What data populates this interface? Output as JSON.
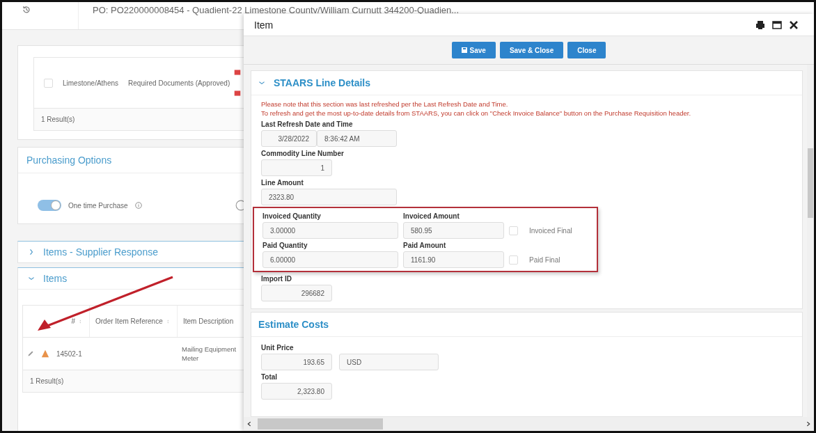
{
  "header": {
    "title": "PO: PO220000008454 - Quadient-22 Limestone Countv/William Curnutt 344200-Quadien..."
  },
  "documents": {
    "rows": [
      {
        "checked": false,
        "location": "Limestone/Athens",
        "document": "Required Documents (Approved)"
      }
    ],
    "footer": "1 Result(s)"
  },
  "purchasing_options": {
    "title": "Purchasing Options",
    "toggle": {
      "label": "One time Purchase",
      "on": true
    }
  },
  "sections": [
    {
      "title": "Items - Supplier Response",
      "expanded": false
    },
    {
      "title": "Items",
      "expanded": true
    }
  ],
  "items_table": {
    "columns": [
      "#",
      "Order Item Reference",
      "Item Description"
    ],
    "rows": [
      {
        "number": "14502-1",
        "description": "Mailing Equipment Meter"
      }
    ],
    "footer": "1 Result(s)"
  },
  "modal": {
    "title": "Item",
    "buttons": [
      {
        "label": "Save",
        "kind": "save"
      },
      {
        "label": "Save & Close",
        "kind": "plain"
      },
      {
        "label": "Close",
        "kind": "plain"
      }
    ],
    "staars": {
      "title": "STAARS Line Details",
      "expanded": true,
      "notes": [
        "Please note that this section was last refreshed per the Last Refresh Date and Time.",
        "To refresh and get the most up-to-date details from STAARS, you can click on \"Check Invoice Balance\" button on the Purchase Requisition header."
      ],
      "last_refresh": {
        "label": "Last Refresh Date and Time",
        "date": "3/28/2022",
        "time": "8:36:42 AM"
      },
      "commodity_line": {
        "label": "Commodity Line Number",
        "value": "1"
      },
      "line_amount": {
        "label": "Line Amount",
        "value": "2323.80"
      },
      "highlighted_rows": [
        {
          "quantity": {
            "label": "Invoiced Quantity",
            "value": "3.00000"
          },
          "amount": {
            "label": "Invoiced Amount",
            "value": "580.95"
          },
          "final": {
            "label": "Invoiced Final",
            "checked": false
          }
        },
        {
          "quantity": {
            "label": "Paid Quantity",
            "value": "6.00000"
          },
          "amount": {
            "label": "Paid Amount",
            "value": "1161.90"
          },
          "final": {
            "label": "Paid Final",
            "checked": false
          }
        }
      ],
      "import_id": {
        "label": "Import ID",
        "value": "296682"
      }
    },
    "estimate": {
      "title": "Estimate Costs",
      "unit_price": {
        "label": "Unit Price",
        "value": "193.65",
        "currency": "USD"
      },
      "total": {
        "label": "Total",
        "value": "2,323.80"
      }
    }
  }
}
